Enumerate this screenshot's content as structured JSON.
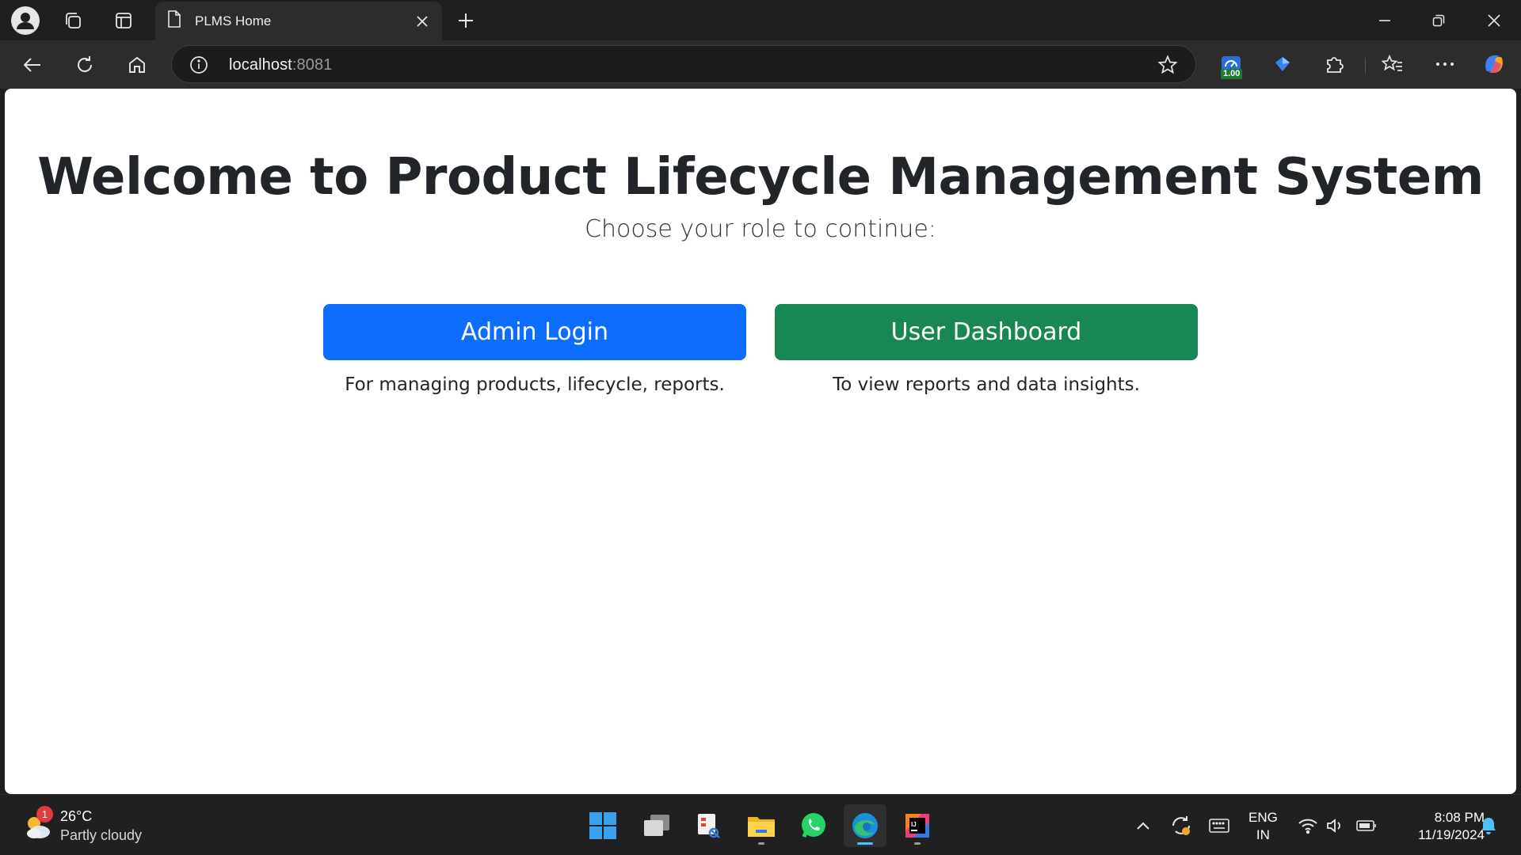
{
  "browser": {
    "tab_title": "PLMS Home",
    "url_host": "localhost",
    "url_port": ":8081",
    "extension_badge": "1.00"
  },
  "page": {
    "title": "Welcome to Product Lifecycle Management System",
    "subtitle": "Choose your role to continue:",
    "roles": [
      {
        "button_label": "Admin Login",
        "description": "For managing products, lifecycle, reports.",
        "color": "#0d6efd"
      },
      {
        "button_label": "User Dashboard",
        "description": "To view reports and data insights.",
        "color": "#198754"
      }
    ]
  },
  "taskbar": {
    "weather_temp": "26°C",
    "weather_condition": "Partly cloudy",
    "weather_badge": "1",
    "language_line1": "ENG",
    "language_line2": "IN",
    "time": "8:08 PM",
    "date": "11/19/2024"
  }
}
